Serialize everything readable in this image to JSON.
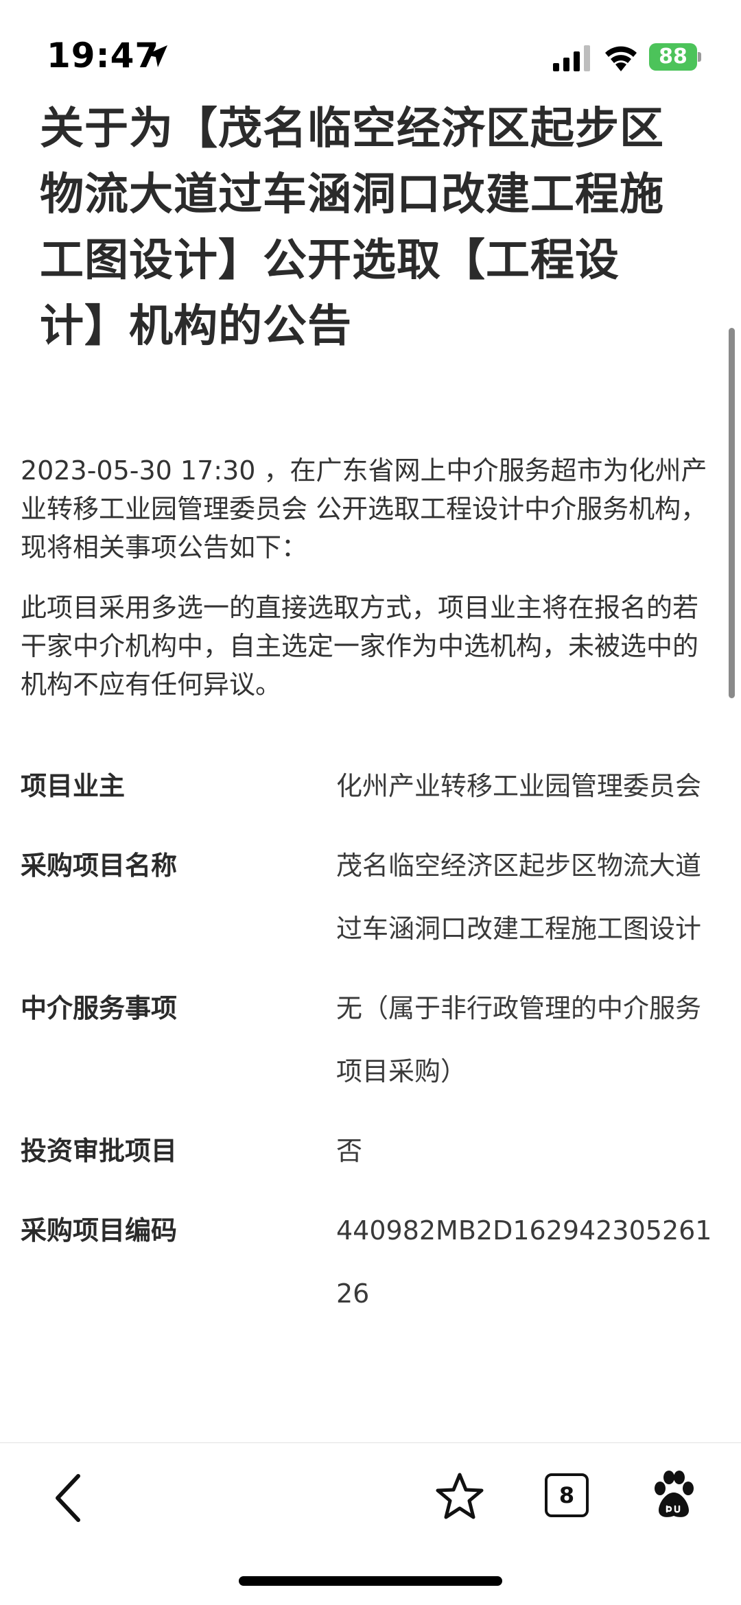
{
  "status_bar": {
    "time": "19:47",
    "battery": "88"
  },
  "article": {
    "title": "关于为【茂名临空经济区起步区物流大道过车涵洞口改建工程施工图设计】公开选取【工程设计】机构的公告",
    "intro": "2023-05-30 17:30 ，在广东省网上中介服务超市为化州产业转移工业园管理委员会 公开选取工程设计中介服务机构，现将相关事项公告如下：",
    "method": "此项目采用多选一的直接选取方式，项目业主将在报名的若干家中介机构中，自主选定一家作为中选机构，未被选中的机构不应有任何异议。"
  },
  "info": [
    {
      "label": "项目业主",
      "value": "化州产业转移工业园管理委员会"
    },
    {
      "label": "采购项目名称",
      "value": "茂名临空经济区起步区物流大道过车涵洞口改建工程施工图设计"
    },
    {
      "label": "中介服务事项",
      "value": "无（属于非行政管理的中介服务项目采购）"
    },
    {
      "label": "投资审批项目",
      "value": "否"
    },
    {
      "label": "采购项目编码",
      "value": "440982MB2D16294230526126"
    }
  ],
  "toolbar": {
    "tab_count": "8"
  },
  "icons": {
    "location": "location-arrow-icon",
    "signal": "cellular-signal-icon",
    "wifi": "wifi-icon",
    "back": "chevron-left-icon",
    "favorite": "star-icon",
    "tabs": "tabs-icon",
    "baidu": "baidu-paw-icon"
  },
  "colors": {
    "battery": "#4cc35a",
    "text_primary": "#2b2b2b"
  }
}
